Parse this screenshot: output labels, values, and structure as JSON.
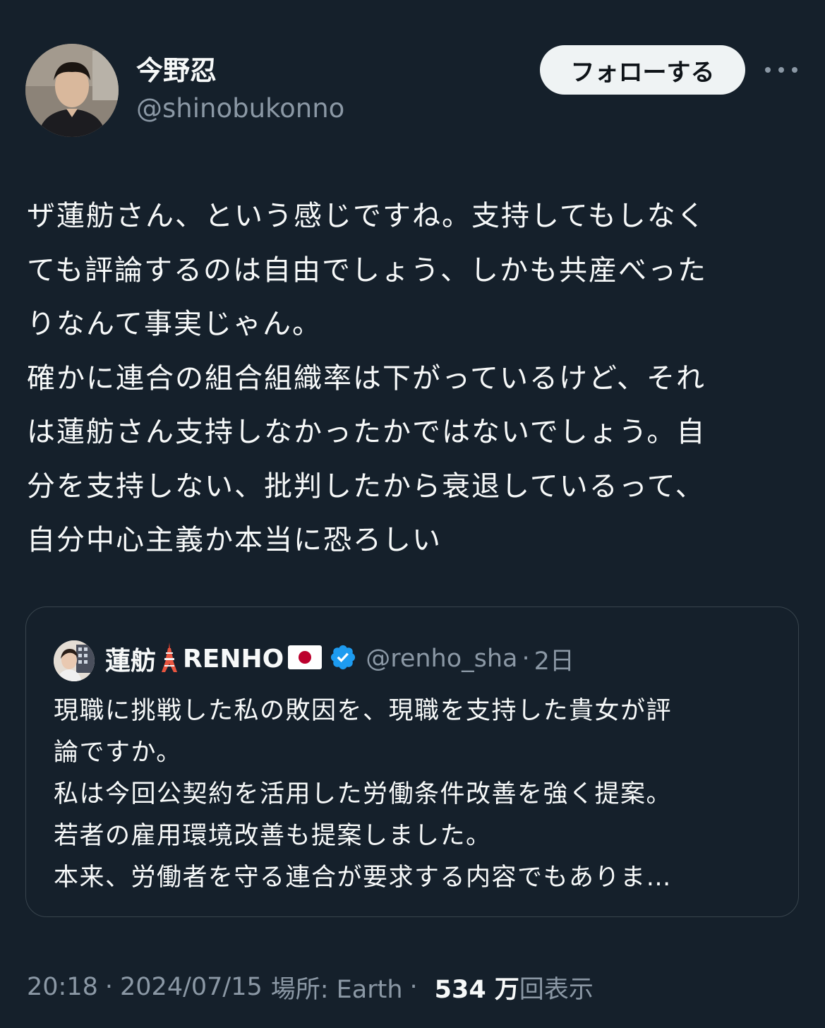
{
  "author": {
    "display_name": "今野忍",
    "handle": "@shinobukonno"
  },
  "follow_label": "フォローする",
  "tweet_text_lines": [
    "ザ蓮舫さん、という感じですね。支持してもしなく",
    "ても評論するのは自由でしょう、しかも共産べった",
    "りなんて事実じゃん。",
    "確かに連合の組合組織率は下がっているけど、それ",
    "は蓮舫さん支持しなかったかではないでしょう。自",
    "分を支持しない、批判したから衰退しているって、",
    "自分中心主義か本当に恐ろしい"
  ],
  "quote": {
    "name": "蓮舫",
    "name_suffix": "RENHO",
    "handle": "@renho_sha",
    "separator": "·",
    "time": "2日",
    "text_lines": [
      "現職に挑戦した私の敗因を、現職を支持した貴女が評",
      "論ですか。",
      "私は今回公契約を活用した労働条件改善を強く提案。",
      "若者の雇用環境改善も提案しました。",
      "本来、労働者を守る連合が要求する内容でもありま…"
    ],
    "icons": [
      "tokyo-tower-icon",
      "japan-flag-icon",
      "verified-badge-icon"
    ]
  },
  "meta": {
    "time": "20:18",
    "sep": "·",
    "date": "2024/07/15",
    "location": "場所: Earth",
    "views_number": "534 万",
    "views_label": "回表示"
  },
  "colors": {
    "background": "#15202b",
    "text": "#f7f9f9",
    "secondary": "#8b98a5",
    "border": "#38444d",
    "verified": "#1d9bf0"
  }
}
